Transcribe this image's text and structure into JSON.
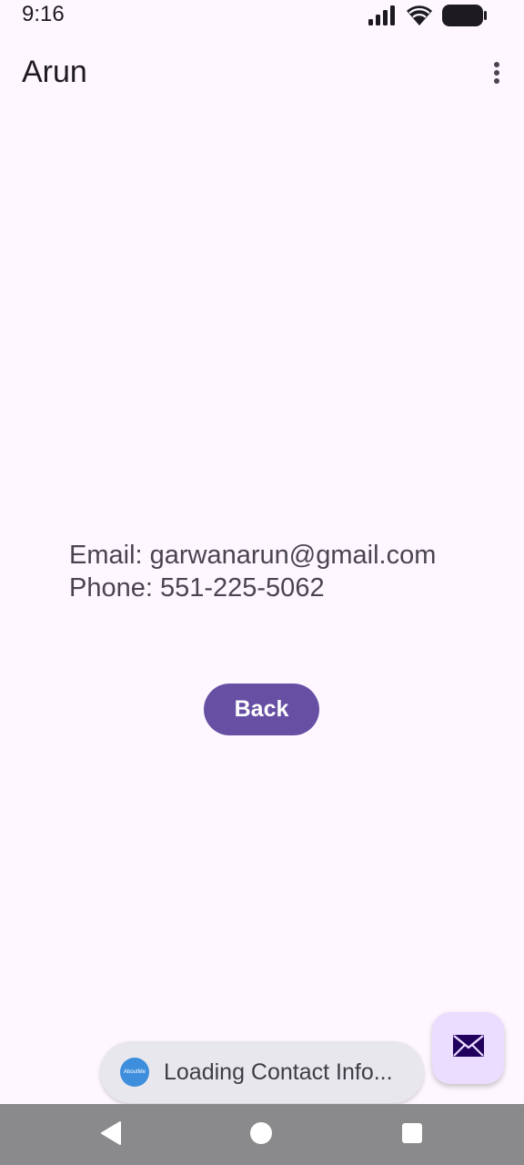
{
  "status_bar": {
    "time": "9:16",
    "icons": [
      "signal-icon",
      "wifi-icon",
      "battery-icon"
    ]
  },
  "app_bar": {
    "title": "Arun",
    "menu_icon": "more-vert-icon"
  },
  "contact": {
    "email_line": "Email: garwanarun@gmail.com",
    "phone_line": "Phone: 551-225-5062"
  },
  "back_button": {
    "label": "Back"
  },
  "toast": {
    "app_icon_label": "AboutMe",
    "message": "Loading Contact Info..."
  },
  "fab": {
    "icon": "email-icon"
  },
  "nav_bar": {
    "buttons": [
      "back-icon",
      "home-icon",
      "recents-icon"
    ]
  },
  "colors": {
    "background": "#FEF7FF",
    "primary": "#6750A4",
    "fab_container": "#EADDFF",
    "toast_background": "#E9E7EE",
    "nav_bar": "#8A8A8C"
  }
}
